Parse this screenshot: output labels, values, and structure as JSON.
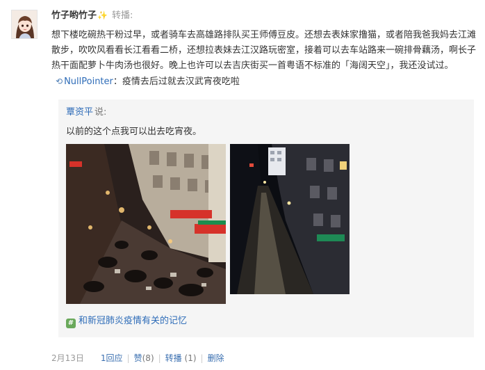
{
  "post": {
    "author": "竹子哟竹子",
    "sparkle": "✨",
    "type_label": "转播:",
    "text": "想下楼吃碗热干粉过早，或者骑车去高雄路排队买王师傅豆皮。还想去表妹家撸猫，或者陪我爸我妈去江滩散步，吹吹风看看长江看看二桥，还想拉表妹去江汉路玩密室，接着可以去车站路来一碗排骨藕汤，啊长子热干面配萝卜牛肉汤也很好。晚上也许可以去吉庆街买一首粤语不标准的「海阔天空」，我还没试过。",
    "repost_user": "NullPointer",
    "repost_text": "：疫情去后过就去汉武宵夜吃啦"
  },
  "quoted": {
    "user": "覃资平",
    "said": "说:",
    "text": "以前的这个点我可以出去吃宵夜。",
    "topic_icon": "#",
    "topic": "和新冠肺炎疫情有关的记忆"
  },
  "footer": {
    "date": "2月13日",
    "reply_count": "1",
    "reply_label": "回应",
    "like_label": "赞",
    "like_count": "(8)",
    "repost_label": "转播",
    "repost_count": "(1)",
    "delete_label": "删除"
  },
  "icons": {
    "avatar": "anime-girl-avatar",
    "repost": "repost-icon",
    "topic": "hashtag-icon"
  },
  "colors": {
    "link": "#2e6cb8",
    "quote_bg": "#f5f5f5",
    "topic_icon": "#6aa95b"
  }
}
